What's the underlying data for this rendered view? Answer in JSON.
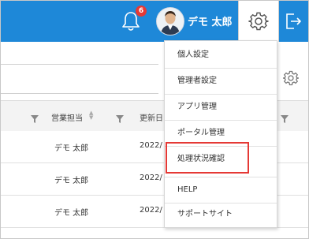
{
  "header": {
    "notification_count": "6",
    "user_name": "デモ 太郎",
    "accent_color": "#1e88d8",
    "icons": [
      "bell-icon",
      "gear-icon",
      "logout-icon"
    ]
  },
  "table": {
    "columns": [
      "営業担当",
      "更新日"
    ],
    "rows": [
      {
        "sales_rep": "デモ 太郎",
        "updated": "2022/"
      },
      {
        "sales_rep": "デモ 太郎",
        "updated": "2022/"
      },
      {
        "sales_rep": "デモ 太郎",
        "updated": "2022/"
      }
    ]
  },
  "settings_menu": {
    "items": [
      "個人設定",
      "管理者設定",
      "アプリ管理",
      "ポータル管理",
      "処理状況確認",
      "HELP",
      "サポートサイト"
    ],
    "highlighted_item": "処理状況確認",
    "highlight_color": "#e53935"
  }
}
